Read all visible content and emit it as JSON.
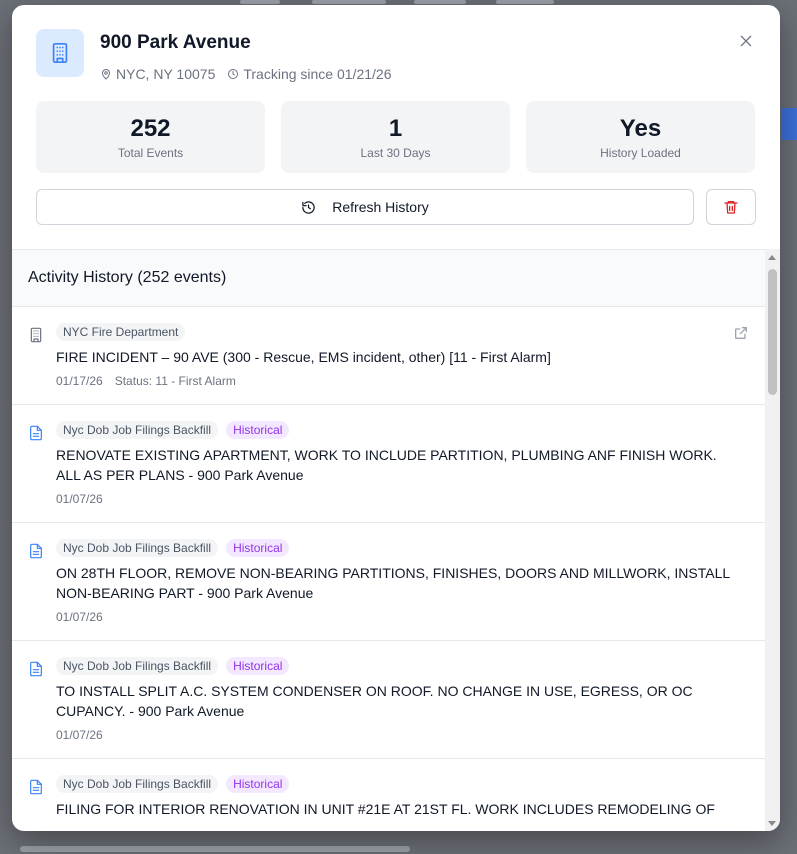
{
  "modal": {
    "title": "900 Park Avenue",
    "location": "NYC, NY 10075",
    "tracking": "Tracking since 01/21/26",
    "stats": [
      {
        "value": "252",
        "label": "Total Events"
      },
      {
        "value": "1",
        "label": "Last 30 Days"
      },
      {
        "value": "Yes",
        "label": "History Loaded"
      }
    ],
    "refresh_label": "Refresh History",
    "section_title": "Activity History (252 events)"
  },
  "events": [
    {
      "source": "NYC Fire Department",
      "badge": "",
      "title": "FIRE INCIDENT – 90 AVE (300 - Rescue, EMS incident, other) [11 - First Alarm]",
      "date": "01/17/26",
      "status": "Status: 11 - First Alarm",
      "icon": "building-icon"
    },
    {
      "source": "Nyc Dob Job Filings Backfill",
      "badge": "Historical",
      "title": "RENOVATE EXISTING APARTMENT, WORK TO INCLUDE PARTITION, PLUMBING ANF FINISH WORK. ALL AS PER PLANS - 900 Park Avenue",
      "date": "01/07/26",
      "status": "",
      "icon": "document-icon"
    },
    {
      "source": "Nyc Dob Job Filings Backfill",
      "badge": "Historical",
      "title": "ON 28TH FLOOR, REMOVE NON-BEARING PARTITIONS, FINISHES, DOORS AND MILLWORK, INSTALL NON-BEARING PART - 900 Park Avenue",
      "date": "01/07/26",
      "status": "",
      "icon": "document-icon"
    },
    {
      "source": "Nyc Dob Job Filings Backfill",
      "badge": "Historical",
      "title": "TO INSTALL SPLIT A.C. SYSTEM CONDENSER ON ROOF. NO CHANGE IN USE, EGRESS, OR OC CUPANCY. - 900 Park Avenue",
      "date": "01/07/26",
      "status": "",
      "icon": "document-icon"
    },
    {
      "source": "Nyc Dob Job Filings Backfill",
      "badge": "Historical",
      "title": "FILING FOR INTERIOR RENOVATION IN UNIT #21E AT 21ST FL. WORK INCLUDES REMODELING OF",
      "date": "",
      "status": "",
      "icon": "document-icon"
    }
  ],
  "colors": {
    "accent_bg": "#dbeafe",
    "accent": "#3b82f6",
    "historical_text": "#9333ea",
    "historical_bg": "#f3e8ff",
    "danger": "#dc2626"
  }
}
